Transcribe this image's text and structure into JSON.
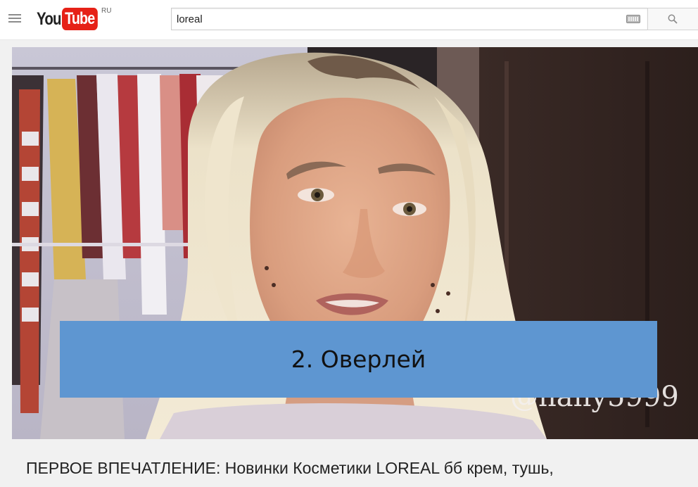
{
  "header": {
    "logo_you": "You",
    "logo_tube": "Tube",
    "country_code": "RU",
    "search_value": "loreal",
    "menu_icon": "hamburger-menu-icon",
    "keyboard_icon": "keyboard-icon",
    "search_icon": "magnifier-icon"
  },
  "video": {
    "watermark": "@nany5999",
    "overlay_label": "2. Оверлей",
    "overlay_color": "#5e96d1",
    "title": "ПЕРВОЕ ВПЕЧАТЛЕНИЕ: Новинки Косметики LOREAL бб крем, тушь,"
  },
  "colors": {
    "brand_red": "#e62117",
    "page_bg": "#f1f1f1"
  }
}
